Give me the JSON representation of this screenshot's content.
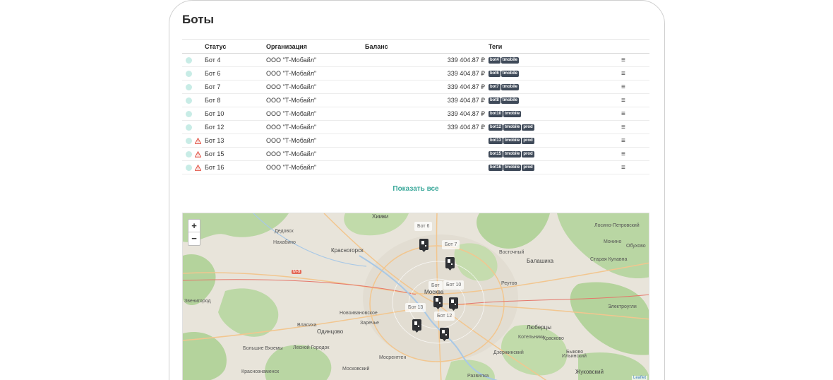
{
  "page": {
    "title": "Боты"
  },
  "table": {
    "headers": {
      "status": "Статус",
      "organization": "Организация",
      "balance": "Баланс",
      "tags": "Теги"
    },
    "rows": [
      {
        "name": "Бот 4",
        "org": "ООО \"Т-Мобайл\"",
        "balance": "339 404.87 ₽",
        "tags": [
          "bot4",
          "tmobile"
        ],
        "warning": false
      },
      {
        "name": "Бот 6",
        "org": "ООО \"Т-Мобайл\"",
        "balance": "339 404.87 ₽",
        "tags": [
          "bot6",
          "tmobile"
        ],
        "warning": false
      },
      {
        "name": "Бот 7",
        "org": "ООО \"Т-Мобайл\"",
        "balance": "339 404.87 ₽",
        "tags": [
          "bot7",
          "tmobile"
        ],
        "warning": false
      },
      {
        "name": "Бот 8",
        "org": "ООО \"Т-Мобайл\"",
        "balance": "339 404.87 ₽",
        "tags": [
          "bot8",
          "tmobile"
        ],
        "warning": false
      },
      {
        "name": "Бот 10",
        "org": "ООО \"Т-Мобайл\"",
        "balance": "339 404.87 ₽",
        "tags": [
          "bot10",
          "tmobile"
        ],
        "warning": false
      },
      {
        "name": "Бот 12",
        "org": "ООО \"Т-Мобайл\"",
        "balance": "339 404.87 ₽",
        "tags": [
          "bot12",
          "tmobile",
          "prod"
        ],
        "warning": false
      },
      {
        "name": "Бот 13",
        "org": "ООО \"Т-Мобайл\"",
        "balance": "",
        "tags": [
          "bot13",
          "tmobile",
          "prod"
        ],
        "warning": true
      },
      {
        "name": "Бот 15",
        "org": "ООО \"Т-Мобайл\"",
        "balance": "",
        "tags": [
          "bot15",
          "tmobile",
          "prod"
        ],
        "warning": true
      },
      {
        "name": "Бот 16",
        "org": "ООО \"Т-Мобайл\"",
        "balance": "",
        "tags": [
          "bot16",
          "tmobile",
          "prod"
        ],
        "warning": true
      }
    ]
  },
  "show_all_label": "Показать все",
  "map": {
    "zoom_in": "+",
    "zoom_out": "−",
    "attribution": "Leaflet",
    "bot_labels": [
      "Бот 6",
      "Бот 7",
      "Бот 10",
      "Бот",
      "Бот 13",
      "Бот 12"
    ],
    "places": [
      {
        "name": "Химки",
        "big": true
      },
      {
        "name": "Дедовск"
      },
      {
        "name": "Нахабино"
      },
      {
        "name": "Красногорск",
        "big": true
      },
      {
        "name": "М-9",
        "road": true
      },
      {
        "name": "Звенигород"
      },
      {
        "name": "Власиха"
      },
      {
        "name": "Одинцово",
        "big": true
      },
      {
        "name": "Новоивановское"
      },
      {
        "name": "Заречье"
      },
      {
        "name": "Большие Вяземы"
      },
      {
        "name": "Лесной Городок"
      },
      {
        "name": "Краснознаменск"
      },
      {
        "name": "Московский"
      },
      {
        "name": "Мосрентген"
      },
      {
        "name": "Балашиха",
        "big": true
      },
      {
        "name": "Восточный"
      },
      {
        "name": "Реутов"
      },
      {
        "name": "Люберцы",
        "big": true
      },
      {
        "name": "Котельники"
      },
      {
        "name": "Дзержинский"
      },
      {
        "name": "Жуковский",
        "big": true
      },
      {
        "name": "Электроугли"
      },
      {
        "name": "Старая Купавна"
      },
      {
        "name": "Обухово"
      },
      {
        "name": "Монино"
      },
      {
        "name": "Лосино-Петровский"
      },
      {
        "name": "Москва",
        "big": true
      },
      {
        "name": "Развилка"
      },
      {
        "name": "Красково"
      },
      {
        "name": "Ильинский"
      },
      {
        "name": "Быково"
      }
    ]
  },
  "colors": {
    "accent": "#3aa89a",
    "tag_bg": "#3f4a59",
    "status_dot": "#c8ece6",
    "warning": "#e2584a"
  }
}
